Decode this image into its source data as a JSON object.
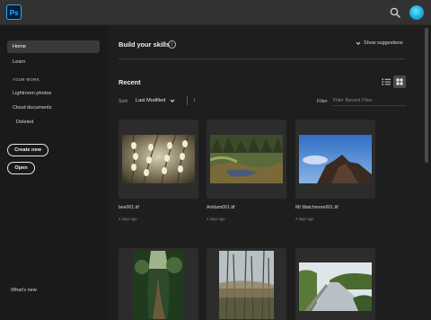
{
  "app": {
    "logo_text": "Ps",
    "brand_color": "#31a8ff"
  },
  "topbar": {
    "search_icon": "search-icon",
    "avatar_icon": "user-avatar"
  },
  "sidebar": {
    "home": "Home",
    "learn": "Learn",
    "section_heading": "YOUR WORK",
    "lightroom": "Lightroom photos",
    "cloud_docs": "Cloud documents",
    "deleted": "Deleted",
    "create_new": "Create new",
    "open": "Open",
    "whats_new": "What's new"
  },
  "skills": {
    "title": "Build your skills",
    "info_icon": "info-icon",
    "show_suggestions": "Show suggestions"
  },
  "recent": {
    "title": "Recent",
    "sort_label": "Sort",
    "sort_value": "Last Modified",
    "filter_label": "Filter",
    "filter_placeholder": "Filter Recent Files",
    "files": [
      {
        "name": "bee001.tif",
        "date": "2 days ago"
      },
      {
        "name": "Anklam001.tif",
        "date": "2 days ago"
      },
      {
        "name": "Mt Watchmore001.tif",
        "date": "2 days ago"
      },
      {
        "name": "",
        "date": ""
      },
      {
        "name": "",
        "date": ""
      },
      {
        "name": "",
        "date": ""
      }
    ]
  }
}
